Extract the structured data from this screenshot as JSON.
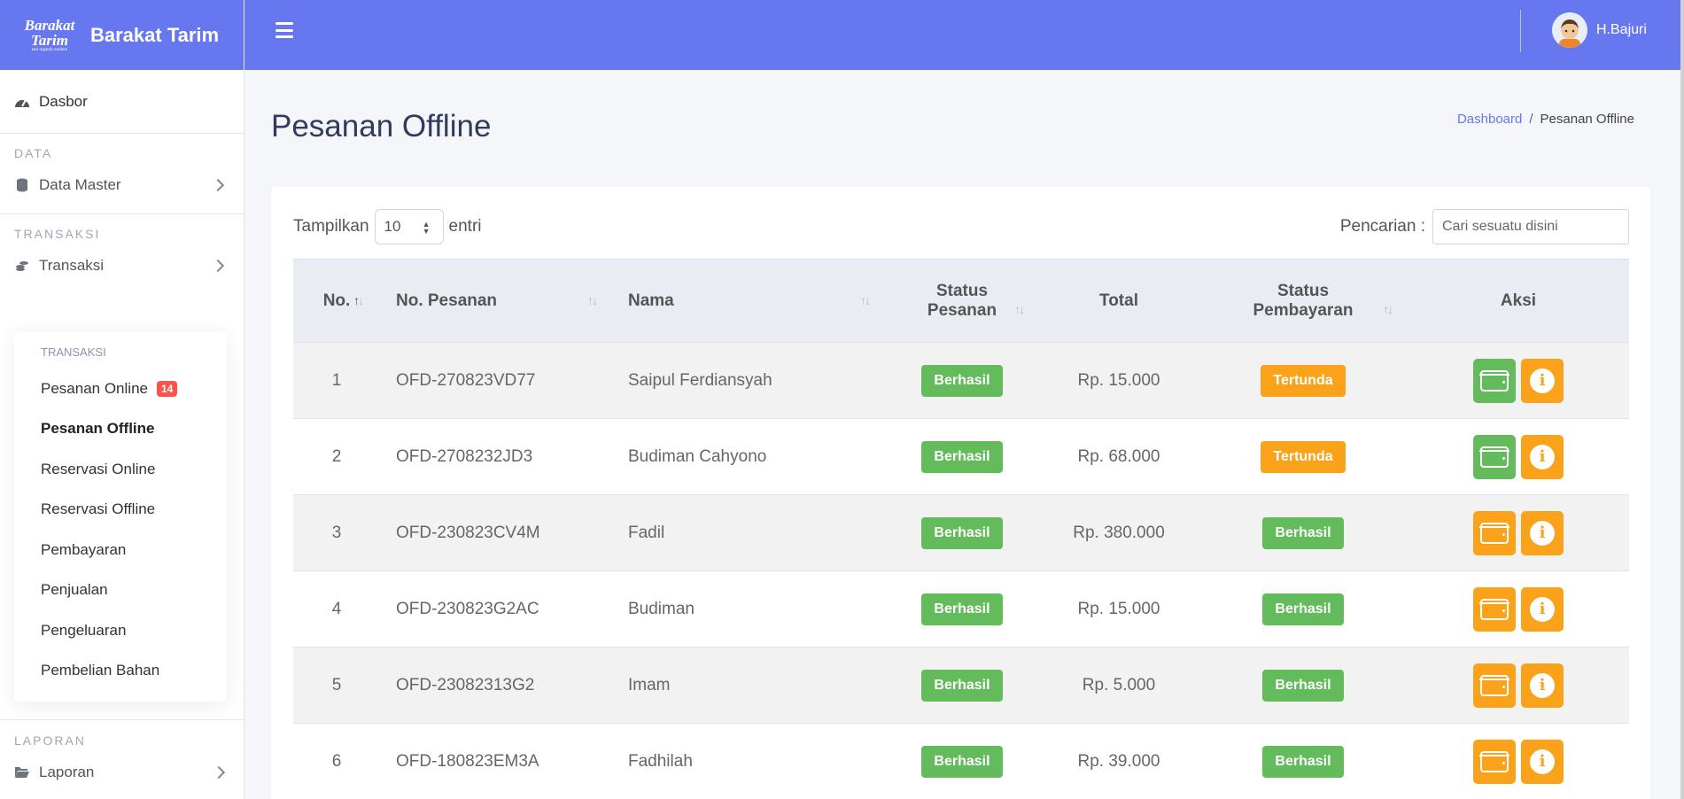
{
  "brand": {
    "logo_line1": "Barakat",
    "logo_line2": "Tarim",
    "logo_tag": "tani organik modern",
    "name": "Barakat Tarim"
  },
  "user": {
    "name": "H.Bajuri"
  },
  "sidebar": {
    "dashboard": "Dasbor",
    "sections": {
      "data": "DATA",
      "transaksi": "TRANSAKSI",
      "laporan": "LAPORAN"
    },
    "data_master": "Data Master",
    "transaksi": "Transaksi",
    "laporan": "Laporan",
    "submenu_title": "TRANSAKSI",
    "submenu": [
      {
        "label": "Pesanan Online",
        "badge": "14"
      },
      {
        "label": "Pesanan Offline"
      },
      {
        "label": "Reservasi Online"
      },
      {
        "label": "Reservasi Offline"
      },
      {
        "label": "Pembayaran"
      },
      {
        "label": "Penjualan"
      },
      {
        "label": "Pengeluaran"
      },
      {
        "label": "Pembelian Bahan"
      }
    ]
  },
  "page": {
    "title": "Pesanan Offline",
    "breadcrumb_home": "Dashboard",
    "breadcrumb_current": "Pesanan Offline"
  },
  "table_controls": {
    "show_label": "Tampilkan",
    "show_value": "10",
    "entries_label": "entri",
    "search_label": "Pencarian :",
    "search_placeholder": "Cari sesuatu disini"
  },
  "table": {
    "headers": {
      "no": "No.",
      "no_pesanan": "No. Pesanan",
      "nama": "Nama",
      "status_pesanan_1": "Status",
      "status_pesanan_2": "Pesanan",
      "total": "Total",
      "status_pembayaran_1": "Status",
      "status_pembayaran_2": "Pembayaran",
      "aksi": "Aksi"
    },
    "rows": [
      {
        "no": "1",
        "kode": "OFD-270823VD77",
        "nama": "Saipul Ferdiansyah",
        "status_pesanan": "Berhasil",
        "total": "Rp. 15.000",
        "status_bayar": "Tertunda"
      },
      {
        "no": "2",
        "kode": "OFD-2708232JD3",
        "nama": "Budiman Cahyono",
        "status_pesanan": "Berhasil",
        "total": "Rp. 68.000",
        "status_bayar": "Tertunda"
      },
      {
        "no": "3",
        "kode": "OFD-230823CV4M",
        "nama": "Fadil",
        "status_pesanan": "Berhasil",
        "total": "Rp. 380.000",
        "status_bayar": "Berhasil"
      },
      {
        "no": "4",
        "kode": "OFD-230823G2AC",
        "nama": "Budiman",
        "status_pesanan": "Berhasil",
        "total": "Rp. 15.000",
        "status_bayar": "Berhasil"
      },
      {
        "no": "5",
        "kode": "OFD-23082313G2",
        "nama": "Imam",
        "status_pesanan": "Berhasil",
        "total": "Rp. 5.000",
        "status_bayar": "Berhasil"
      },
      {
        "no": "6",
        "kode": "OFD-180823EM3A",
        "nama": "Fadhilah",
        "status_pesanan": "Berhasil",
        "total": "Rp. 39.000",
        "status_bayar": "Berhasil"
      }
    ]
  },
  "colors": {
    "primary": "#6777ef",
    "success": "#63bb5b",
    "warning": "#f9a21a",
    "danger": "#fc544b"
  }
}
